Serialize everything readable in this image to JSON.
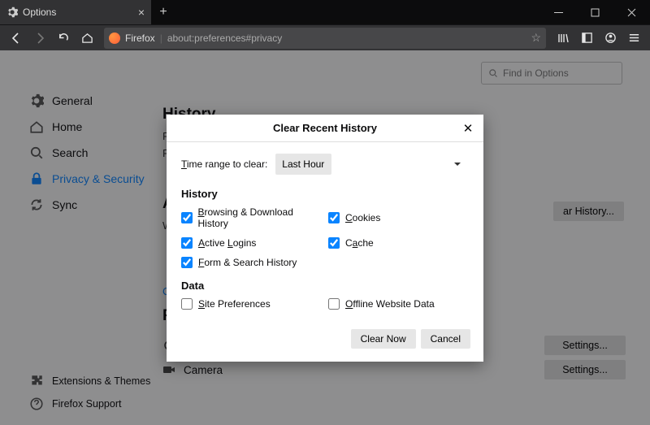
{
  "tab": {
    "title": "Options"
  },
  "url": {
    "fxlabel": "Firefox",
    "value": "about:preferences#privacy"
  },
  "find": {
    "placeholder": "Find in Options"
  },
  "sidebar": {
    "items": [
      {
        "label": "General"
      },
      {
        "label": "Home"
      },
      {
        "label": "Search"
      },
      {
        "label": "Privacy & Security"
      },
      {
        "label": "Sync"
      }
    ],
    "footer": [
      {
        "label": "Extensions & Themes"
      },
      {
        "label": "Firefox Support"
      }
    ]
  },
  "main": {
    "history": {
      "heading": "History",
      "l1": "F",
      "l2": "F",
      "clearBtn": "ar History..."
    },
    "aw": {
      "heading": "A",
      "sub": "W",
      "link": "C"
    },
    "permissions": {
      "heading": "Permissions",
      "items": [
        {
          "label": "Location",
          "btn": "Settings..."
        },
        {
          "label": "Camera",
          "btn": "Settings..."
        }
      ]
    }
  },
  "dialog": {
    "title": "Clear Recent History",
    "rangeLabel": "Time range to clear:",
    "rangeValue": "Last Hour",
    "h_history": "History",
    "h_data": "Data",
    "cks": {
      "browsing": "Browsing & Download History",
      "cookies": "Cookies",
      "logins": "Active Logins",
      "cache": "Cache",
      "form": "Form & Search History",
      "siteprefs": "Site Preferences",
      "offline": "Offline Website Data"
    },
    "btn_clear": "Clear Now",
    "btn_cancel": "Cancel"
  }
}
